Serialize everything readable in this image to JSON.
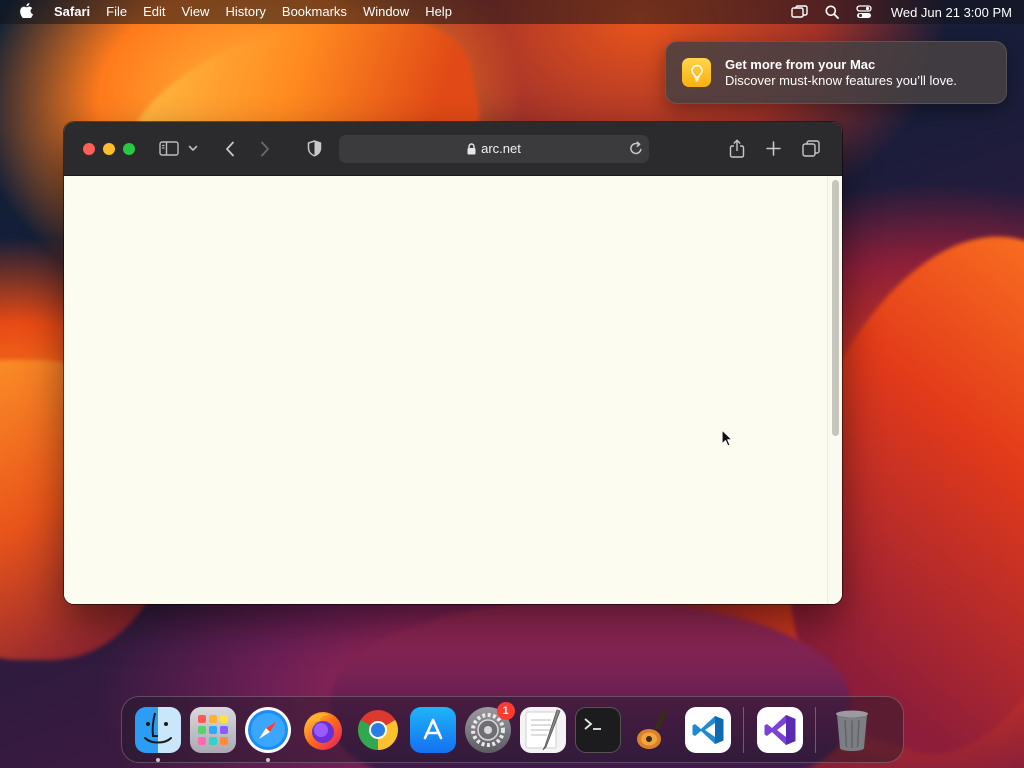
{
  "menubar": {
    "apple_icon": "apple-logo-icon",
    "app_name": "Safari",
    "items": [
      "File",
      "Edit",
      "View",
      "History",
      "Bookmarks",
      "Window",
      "Help"
    ],
    "clock": "Wed Jun 21  3:00 PM"
  },
  "notification": {
    "title": "Get more from your Mac",
    "body": "Discover must-know features you’ll love.",
    "icon": "lightbulb-icon",
    "accent": "#f5b10f"
  },
  "browser": {
    "address": "arc.net",
    "content_background": "#fdfcf0"
  },
  "dock": {
    "apps": [
      {
        "name": "Finder",
        "running": true
      },
      {
        "name": "Launchpad",
        "running": false
      },
      {
        "name": "Safari",
        "running": true
      },
      {
        "name": "Firefox",
        "running": false
      },
      {
        "name": "Google Chrome",
        "running": false
      },
      {
        "name": "App Store",
        "running": false
      },
      {
        "name": "System Settings",
        "running": false,
        "badge": "1"
      },
      {
        "name": "TextEdit",
        "running": false
      },
      {
        "name": "Terminal",
        "running": false
      },
      {
        "name": "GarageBand",
        "running": false
      },
      {
        "name": "Visual Studio Code",
        "running": false
      },
      {
        "name": "Visual Studio",
        "running": false
      },
      {
        "name": "Trash",
        "running": false
      }
    ]
  }
}
